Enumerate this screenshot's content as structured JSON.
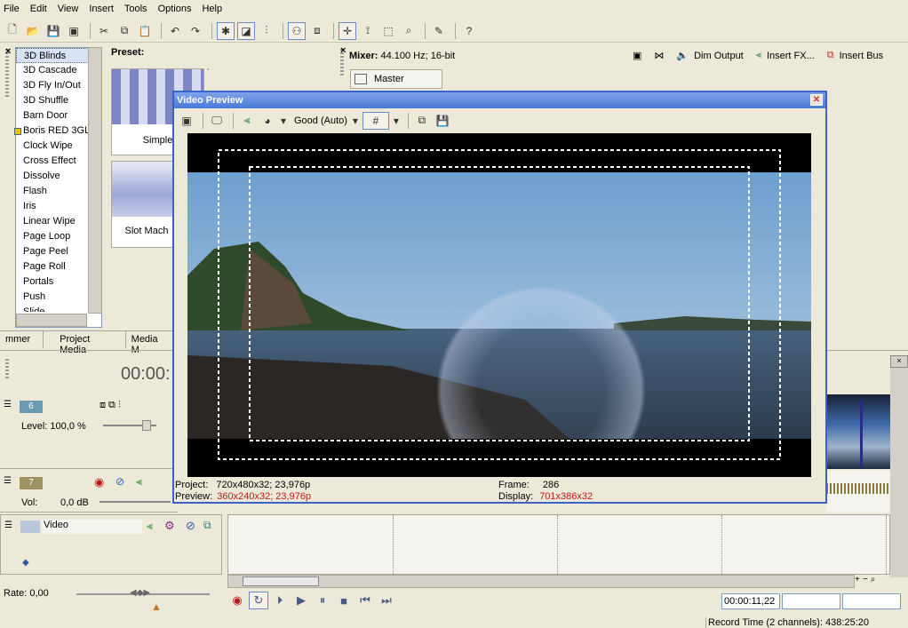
{
  "menu": [
    "File",
    "Edit",
    "View",
    "Insert",
    "Tools",
    "Options",
    "Help"
  ],
  "transitions": {
    "items": [
      "3D Blinds",
      "3D Cascade",
      "3D Fly In/Out",
      "3D Shuffle",
      "Barn Door",
      "Boris RED 3GL",
      "Clock Wipe",
      "Cross Effect",
      "Dissolve",
      "Flash",
      "Iris",
      "Linear Wipe",
      "Page Loop",
      "Page Peel",
      "Page Roll",
      "Portals",
      "Push",
      "Slide"
    ],
    "selected": "3D Blinds",
    "preset_label": "Preset:",
    "thumb1_label": "Simple",
    "thumb2_label": "Slot Mach"
  },
  "tabs": [
    "mmer",
    "Project Media",
    "Media M"
  ],
  "mixer": {
    "label": "Mixer:",
    "info": "44.100 Hz; 16-bit",
    "dim_output": "Dim Output",
    "insert_fx": "Insert FX...",
    "insert_bus": "Insert Bus",
    "master": "Master"
  },
  "time_display": "00:00:",
  "tracks": {
    "t6": {
      "num": "6",
      "level": "Level: 100,0 %"
    },
    "t7": {
      "num": "7",
      "vol_label": "Vol:",
      "vol_value": "0,0 dB"
    },
    "video": {
      "name": "Video"
    },
    "rate": "Rate: 0,00"
  },
  "preview": {
    "title": "Video Preview",
    "quality": "Good (Auto)",
    "project_label": "Project:",
    "project_value": "720x480x32; 23,976p",
    "preview_label": "Preview:",
    "preview_value": "360x240x32; 23,976p",
    "frame_label": "Frame:",
    "frame_value": "286",
    "display_label": "Display:",
    "display_value": "701x386x32"
  },
  "timecode": "00:00:11,22",
  "record_time": "Record Time (2 channels): 438:25:20"
}
